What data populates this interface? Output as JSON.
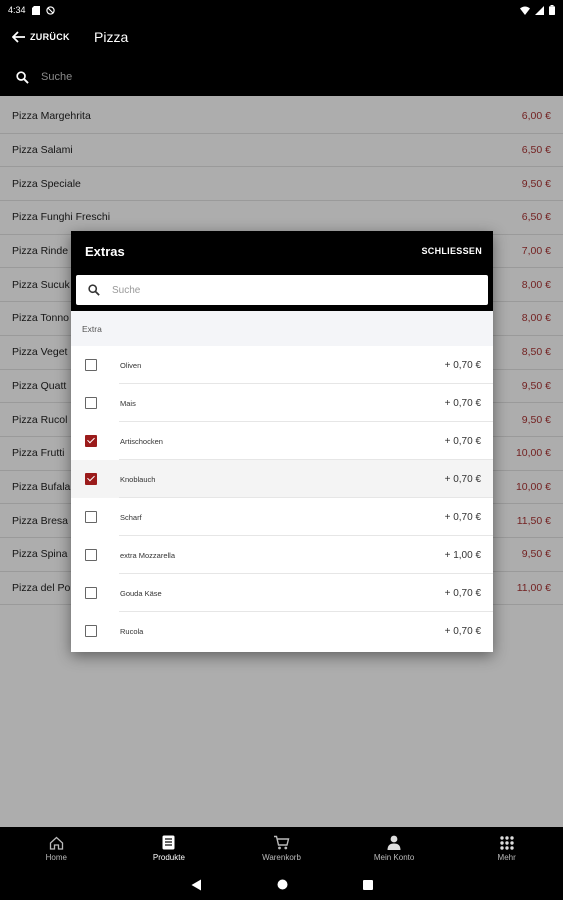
{
  "status_bar": {
    "time": "4:34"
  },
  "header": {
    "back_label": "ZURÜCK",
    "title": "Pizza",
    "search_placeholder": "Suche"
  },
  "products": [
    {
      "name": "Pizza Margehrita",
      "price": "6,00 €"
    },
    {
      "name": "Pizza Salami",
      "price": "6,50 €"
    },
    {
      "name": "Pizza Speciale",
      "price": "9,50 €"
    },
    {
      "name": "Pizza Funghi Freschi",
      "price": "6,50 €"
    },
    {
      "name": "Pizza Rinde",
      "price": "7,00 €"
    },
    {
      "name": "Pizza Sucuk",
      "price": "8,00 €"
    },
    {
      "name": "Pizza Tonno",
      "price": "8,00 €"
    },
    {
      "name": "Pizza Veget",
      "price": "8,50 €"
    },
    {
      "name": "Pizza Quatt",
      "price": "9,50 €"
    },
    {
      "name": "Pizza Rucol",
      "price": "9,50 €"
    },
    {
      "name": "Pizza Frutti",
      "price": "10,00 €"
    },
    {
      "name": "Pizza Bufala",
      "price": "10,00 €"
    },
    {
      "name": "Pizza Bresa",
      "price": "11,50 €"
    },
    {
      "name": "Pizza Spina",
      "price": "9,50 €"
    },
    {
      "name": "Pizza del Po",
      "price": "11,00 €"
    }
  ],
  "dialog": {
    "title": "Extras",
    "close_label": "SCHLIESSEN",
    "search_placeholder": "Suche",
    "section_label": "Extra",
    "items": [
      {
        "name": "Oliven",
        "price": "+ 0,70 €",
        "checked": false
      },
      {
        "name": "Mais",
        "price": "+ 0,70 €",
        "checked": false
      },
      {
        "name": "Artischocken",
        "price": "+ 0,70 €",
        "checked": true
      },
      {
        "name": "Knoblauch",
        "price": "+ 0,70 €",
        "checked": true
      },
      {
        "name": "Scharf",
        "price": "+ 0,70 €",
        "checked": false
      },
      {
        "name": "extra Mozzarella",
        "price": "+ 1,00 €",
        "checked": false
      },
      {
        "name": "Gouda Käse",
        "price": "+ 0,70 €",
        "checked": false
      },
      {
        "name": "Rucola",
        "price": "+ 0,70 €",
        "checked": false
      }
    ]
  },
  "bottom_nav": [
    {
      "label": "Home",
      "icon": "home-icon",
      "active": false
    },
    {
      "label": "Produkte",
      "icon": "menu-book-icon",
      "active": true
    },
    {
      "label": "Warenkorb",
      "icon": "cart-icon",
      "active": false
    },
    {
      "label": "Mein Konto",
      "icon": "person-icon",
      "active": false
    },
    {
      "label": "Mehr",
      "icon": "grid-icon",
      "active": false
    }
  ],
  "colors": {
    "accent": "#9b1b1b",
    "price_text": "#aa3333",
    "header_bg": "#000000"
  }
}
